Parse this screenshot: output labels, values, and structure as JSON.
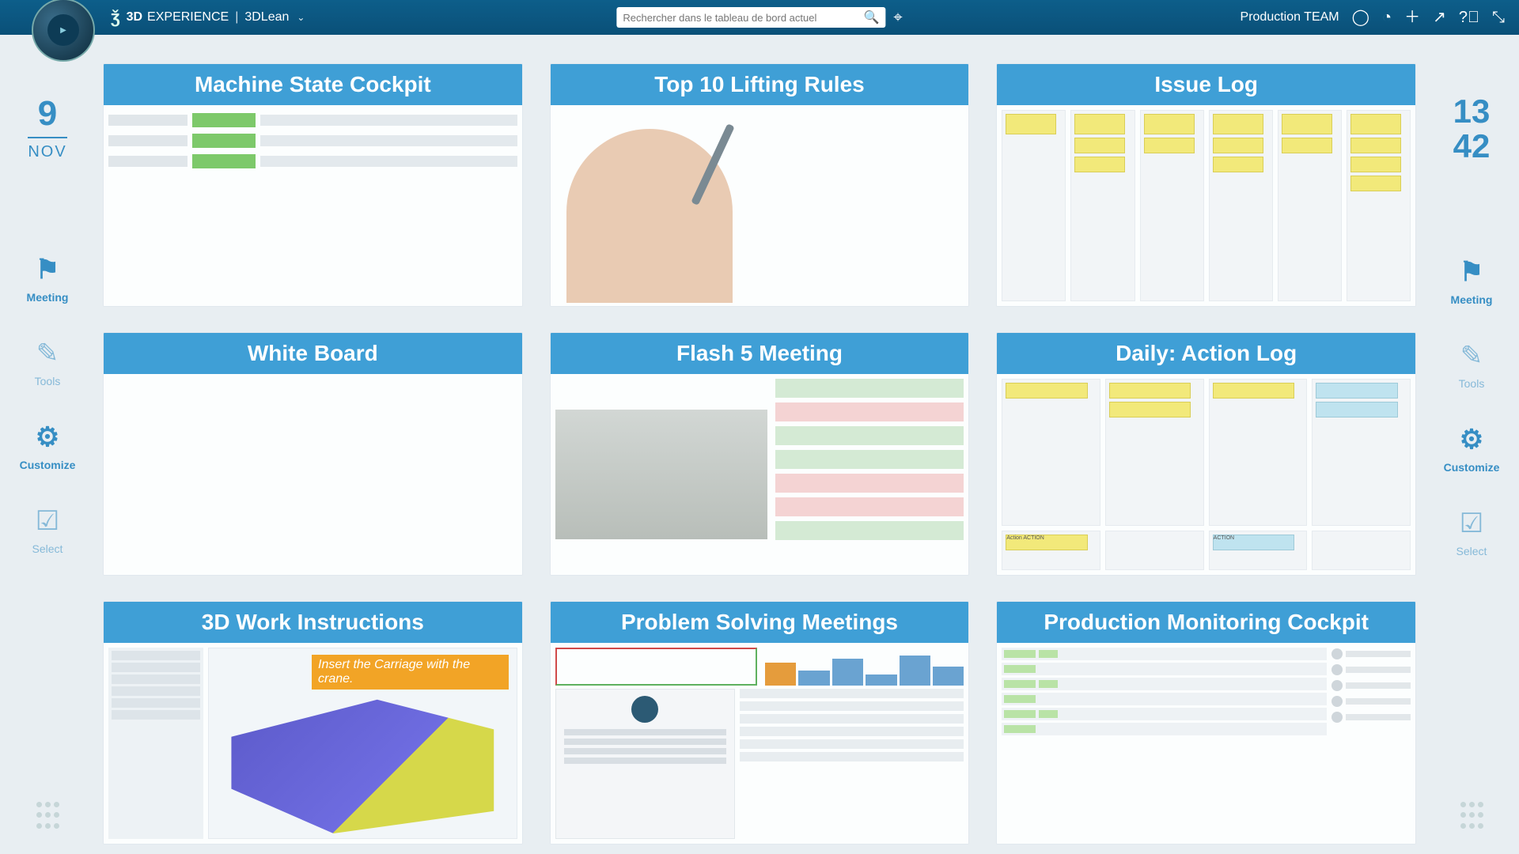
{
  "header": {
    "brand_bold": "3D",
    "brand_rest": "EXPERIENCE",
    "context": "3DLean",
    "search_placeholder": "Rechercher dans le tableau de bord actuel",
    "team_label": "Production TEAM"
  },
  "date": {
    "day": "9",
    "month": "NOV"
  },
  "time": {
    "hour": "13",
    "minute": "42"
  },
  "rail": {
    "meeting": "Meeting",
    "tools": "Tools",
    "customize": "Customize",
    "select": "Select"
  },
  "cards": {
    "machine_state": "Machine State Cockpit",
    "lifting": "Top 10 Lifting Rules",
    "issue_log": "Issue Log",
    "white_board": "White Board",
    "flash5": "Flash 5 Meeting",
    "daily": "Daily: Action Log",
    "work_instr": "3D Work Instructions",
    "problem": "Problem Solving Meetings",
    "prod_mon": "Production Monitoring Cockpit",
    "wi_tip": "Insert the Carriage with the crane.",
    "action_note": "Action ACTION",
    "action_note2": "ACTION"
  },
  "colors": {
    "accent": "#3f9fd6",
    "rail": "#368ec4",
    "topbar": "#0d5e8a"
  }
}
